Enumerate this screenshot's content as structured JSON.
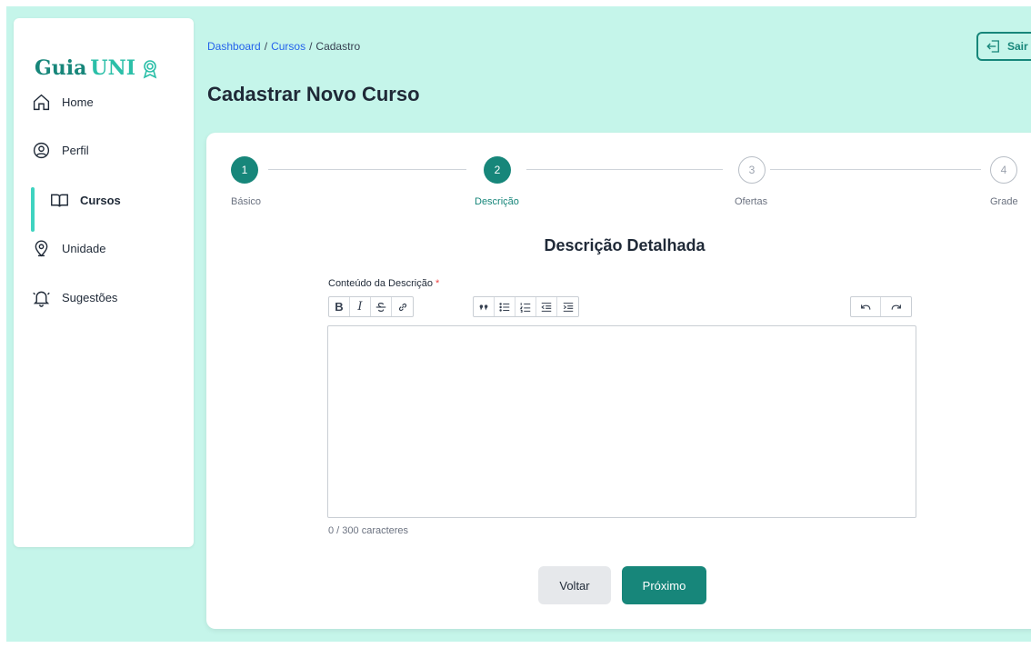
{
  "app": {
    "logo_part1": "Guia",
    "logo_part2": "UNI"
  },
  "sidebar": {
    "items": [
      {
        "label": "Home",
        "icon": "home-icon"
      },
      {
        "label": "Perfil",
        "icon": "user-circle-icon"
      },
      {
        "label": "Cursos",
        "icon": "book-icon",
        "active": true
      },
      {
        "label": "Unidade",
        "icon": "map-pin-icon"
      },
      {
        "label": "Sugestões",
        "icon": "bell-icon"
      }
    ]
  },
  "header": {
    "breadcrumb": [
      "Dashboard",
      "/",
      "Cursos",
      "/",
      "Cadastro"
    ],
    "title": "Cadastrar Novo Curso",
    "logout_label": "Sair"
  },
  "stepper": {
    "steps": [
      {
        "number": "1",
        "label": "Básico",
        "state": "completed"
      },
      {
        "number": "2",
        "label": "Descrição",
        "state": "current"
      },
      {
        "number": "3",
        "label": "Ofertas",
        "state": "pending"
      },
      {
        "number": "4",
        "label": "Grade",
        "state": "pending"
      }
    ]
  },
  "form": {
    "section_title": "Descrição Detalhada",
    "field_label": "Conteúdo da Descrição",
    "required_mark": "*",
    "editor_value": "",
    "char_count": "0 / 300 caracteres"
  },
  "toolbar": {
    "bold": "B",
    "italic": "I",
    "icons": [
      "strikethrough-icon",
      "link-icon",
      "quote-icon",
      "bullet-list-icon",
      "numbered-list-icon",
      "outdent-icon",
      "indent-icon",
      "undo-icon",
      "redo-icon"
    ]
  },
  "actions": {
    "back_label": "Voltar",
    "next_label": "Próximo"
  },
  "colors": {
    "accent": "#17867a",
    "background": "#c5f5ea",
    "active_bar": "#3fd3c0"
  }
}
